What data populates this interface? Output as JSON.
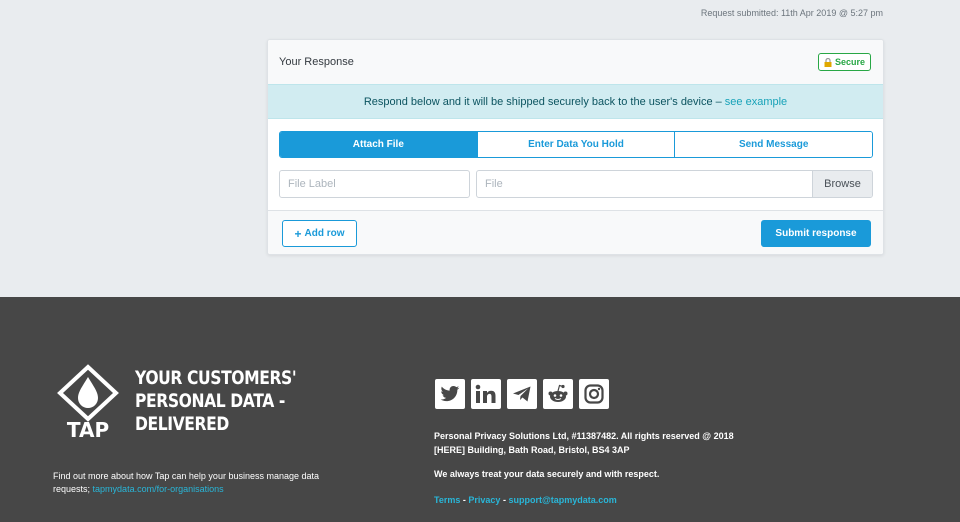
{
  "header": {
    "request_submitted": "Request submitted: 11th Apr 2019 @ 5:27 pm"
  },
  "response_card": {
    "title": "Your Response",
    "secure_badge": "Secure",
    "banner_text": "Respond below and it will be shipped securely back to the user's device –",
    "banner_link": "see example",
    "tabs": [
      {
        "label": "Attach File",
        "active": true
      },
      {
        "label": "Enter Data You Hold",
        "active": false
      },
      {
        "label": "Send Message",
        "active": false
      }
    ],
    "file_label_placeholder": "File Label",
    "file_placeholder": "File",
    "browse_label": "Browse",
    "add_row_label": "Add row",
    "submit_label": "Submit response"
  },
  "footer": {
    "logo_text": "TAP",
    "tagline": [
      "YOUR CUSTOMERS'",
      "PERSONAL DATA -",
      "DELIVERED"
    ],
    "find_more_text": "Find out more about how Tap can help your business manage data requests;",
    "find_more_link": "tapmydata.com/for-organisations",
    "social_icons": [
      "twitter-icon",
      "linkedin-icon",
      "telegram-icon",
      "reddit-icon",
      "instagram-icon"
    ],
    "company_line1": "Personal Privacy Solutions Ltd, #11387482. All rights reserved @ 2018",
    "company_line2": "[HERE] Building, Bath Road, Bristol, BS4 3AP",
    "treat_text": "We always treat your data securely and with respect.",
    "link_terms": "Terms",
    "link_privacy": "Privacy",
    "link_support": "support@tapmydata.com",
    "separator": "-"
  },
  "colors": {
    "primary": "#1a9ad9",
    "success": "#28a745",
    "info_bg": "#d1ecf1",
    "footer_bg": "#474747",
    "footer_link": "#29b6d8"
  }
}
